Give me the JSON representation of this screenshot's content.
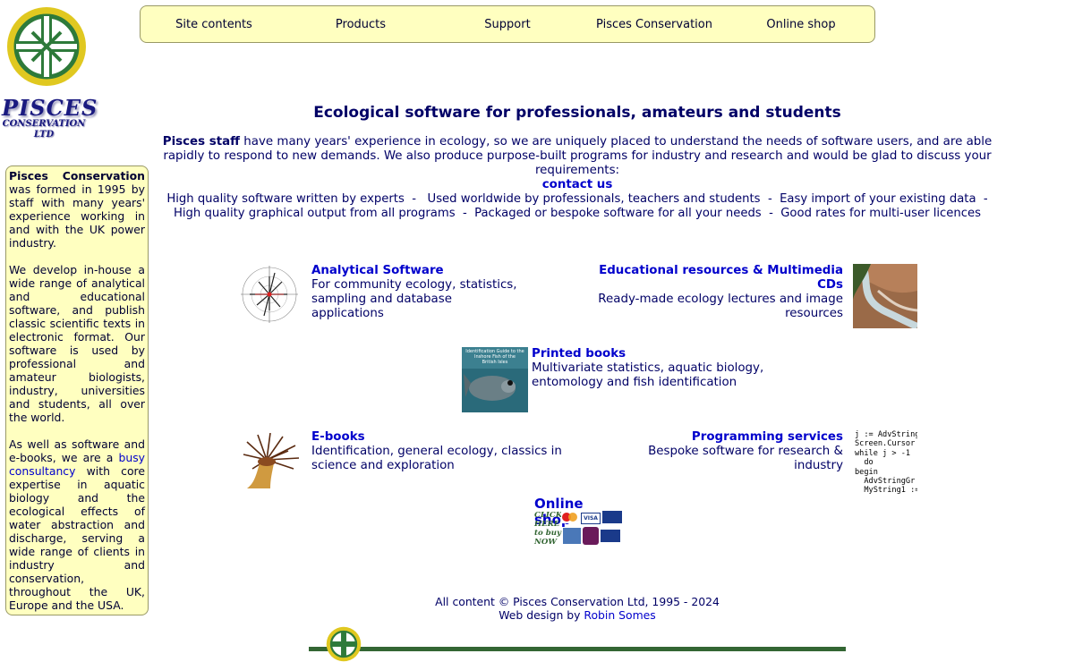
{
  "logo": {
    "name": "PISCES",
    "sub1": "CONSERVATION",
    "sub2": "LTD"
  },
  "nav": [
    "Site contents",
    "Products",
    "Support",
    "Pisces Conservation",
    "Online shop"
  ],
  "sidebar": {
    "p1_bold": "Pisces Conservation",
    "p1_rest": " was formed in 1995 by staff with many years' experience working in and with the UK power industry.",
    "p2": "We develop in-house a wide range of analytical and educational software, and publish classic scientific texts in electronic format. Our software is used by professional and amateur biologists, industry, universities and students, all over the world.",
    "p3_a": "As well as software and e-books, we are a ",
    "p3_link": "busy consultancy",
    "p3_b": " with core expertise in aquatic biology and the ecological effects of water abstraction and discharge, serving a wide range of clients in industry and conservation, throughout the UK, Europe and the USA."
  },
  "headline": "Ecological software for professionals, amateurs and students",
  "intro": {
    "bold": "Pisces staff",
    "text": " have many years' experience in ecology, so we are uniquely placed to understand the needs of software users, and are able rapidly to respond to new demands. We also produce purpose-built programs for industry and research and would be glad to discuss your requirements:",
    "link": "contact us"
  },
  "features": {
    "line1": "High quality software written by experts  -   Used worldwide by professionals, teachers and students  -  Easy import of your existing data  -",
    "line2": "High quality graphical output from all programs  -  Packaged or bespoke software for all your needs  -  Good rates for multi-user licences"
  },
  "tiles": {
    "analytical": {
      "title": "Analytical Software",
      "desc": "For community ecology, statistics, sampling and database applications"
    },
    "educational": {
      "title": "Educational resources & Multimedia CDs",
      "desc": "Ready-made ecology lectures and image resources"
    },
    "books": {
      "title": "Printed books",
      "desc": "Multivariate statistics, aquatic biology, entomology and fish identification",
      "cover_text": "Identification Guide to the Inshore Fish of the British Isles"
    },
    "ebooks": {
      "title": "E-books",
      "desc": "Identification, general ecology, classics in science and exploration"
    },
    "programming": {
      "title": "Programming services",
      "desc": "Bespoke software for research & industry"
    }
  },
  "code_sample": "j := AdvString\nScreen.Cursor\nwhile j > -1\n  do\nbegin\n  AdvStringGr\n  MyString1 :=",
  "shop": {
    "title": "Online shop",
    "click": "CLICK HERE to buy NOW"
  },
  "footer": {
    "line1": "All content © Pisces Conservation Ltd, 1995 - 2024",
    "line2_a": "Web design by ",
    "line2_link": "Robin Somes"
  },
  "colors": {
    "nav_bg": "#ffffc0",
    "link": "#0000cc",
    "text": "#000066",
    "green": "#336633"
  }
}
